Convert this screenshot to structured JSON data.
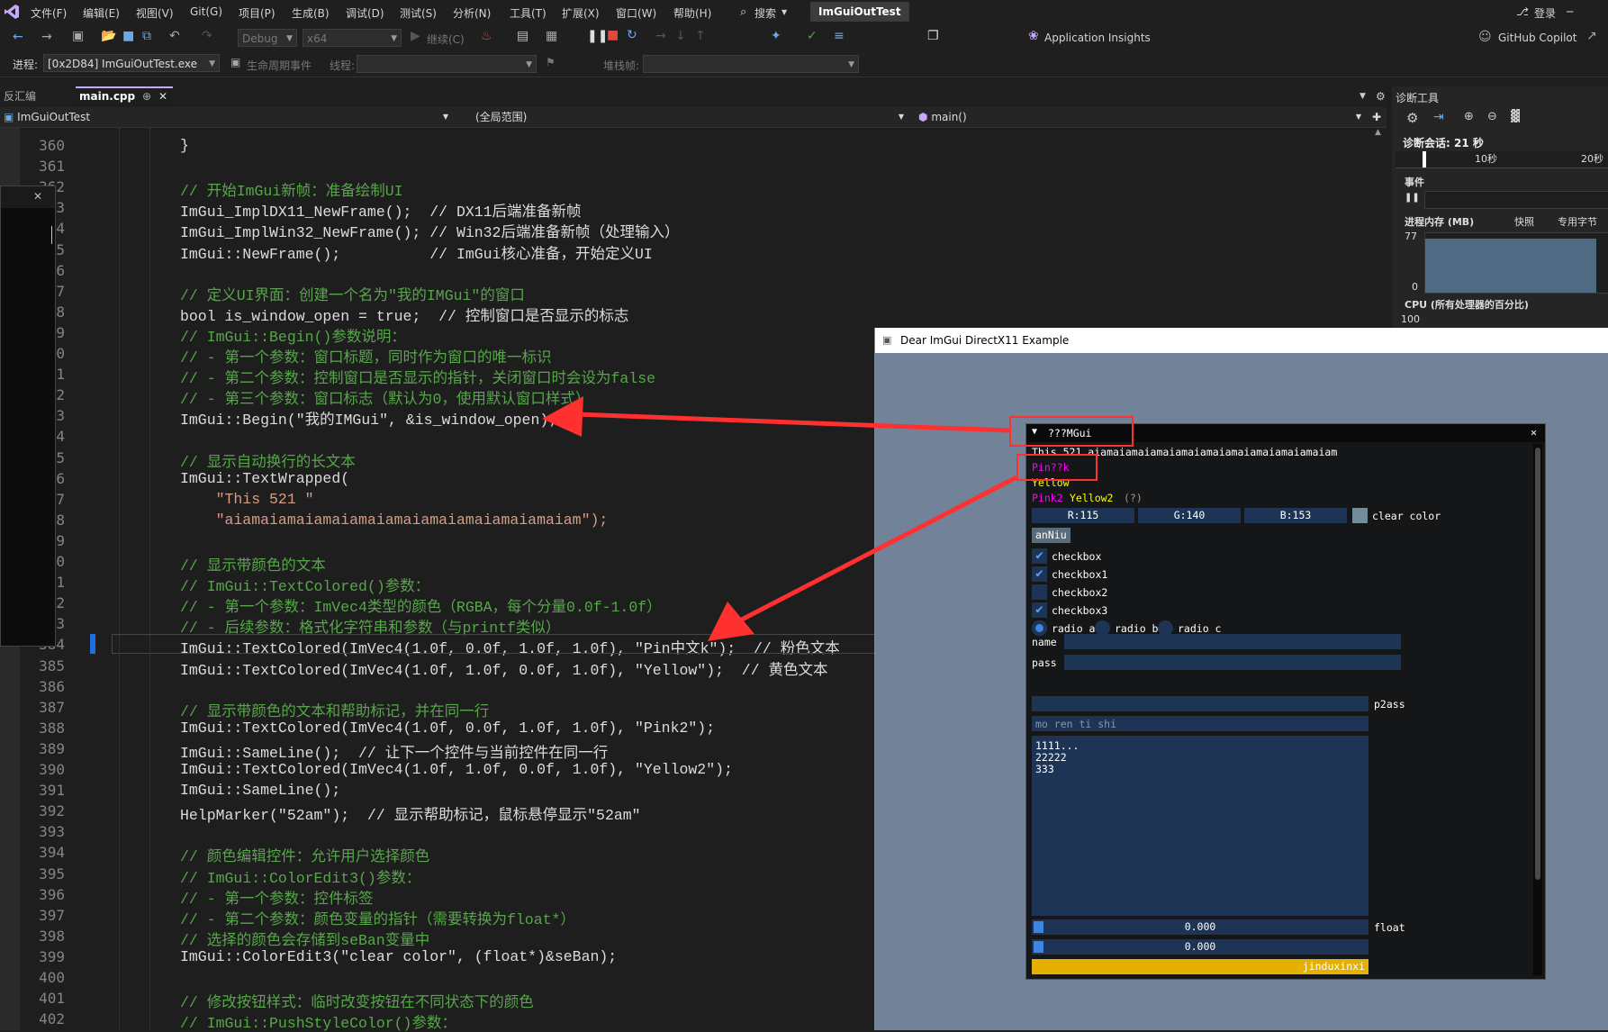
{
  "menu": {
    "items": [
      "文件(F)",
      "编辑(E)",
      "视图(V)",
      "Git(G)",
      "项目(P)",
      "生成(B)",
      "调试(D)",
      "测试(S)",
      "分析(N)",
      "工具(T)",
      "扩展(X)",
      "窗口(W)",
      "帮助(H)"
    ],
    "search_label": "搜索",
    "solution_title": "ImGuiOutTest",
    "login_label": "登录"
  },
  "toolbar": {
    "config": "Debug",
    "platform": "x64",
    "continue_label": "继续(C)",
    "app_insights": "Application Insights",
    "copilot": "GitHub Copilot",
    "process_label": "进程:",
    "process_value": "[0x2D84] ImGuiOutTest.exe",
    "lifecycle_label": "生命周期事件",
    "thread_label": "线程:",
    "stackframe_label": "堆栈帧:"
  },
  "tabs": {
    "disasm": "反汇编",
    "main": "main.cpp",
    "pin_icon": "pin-icon",
    "close_icon": "close-icon"
  },
  "navbar": {
    "project": "ImGuiOutTest",
    "scope": "(全局范围)",
    "member": "main()"
  },
  "editor": {
    "lines": [
      {
        "n": "360",
        "t": "}",
        "c": "plain"
      },
      {
        "n": "361",
        "t": "",
        "c": "plain"
      },
      {
        "n": "362",
        "t": "// 开始ImGui新帧：准备绘制UI",
        "c": "cmt"
      },
      {
        "n": "363",
        "t": "ImGui_ImplDX11_NewFrame();  // DX11后端准备新帧",
        "c": "mix"
      },
      {
        "n": "364",
        "t": "ImGui_ImplWin32_NewFrame(); // Win32后端准备新帧（处理输入）",
        "c": "mix"
      },
      {
        "n": "365",
        "t": "ImGui::NewFrame();          // ImGui核心准备，开始定义UI",
        "c": "mix"
      },
      {
        "n": "366",
        "t": "",
        "c": "plain"
      },
      {
        "n": "367",
        "t": "// 定义UI界面：创建一个名为\"我的IMGui\"的窗口",
        "c": "cmt"
      },
      {
        "n": "368",
        "t": "bool is_window_open = true;  // 控制窗口是否显示的标志",
        "c": "mix"
      },
      {
        "n": "369",
        "t": "// ImGui::Begin()参数说明：",
        "c": "cmt"
      },
      {
        "n": "370",
        "t": "// - 第一个参数：窗口标题，同时作为窗口的唯一标识",
        "c": "cmt"
      },
      {
        "n": "371",
        "t": "// - 第二个参数：控制窗口是否显示的指针，关闭窗口时会设为false",
        "c": "cmt"
      },
      {
        "n": "372",
        "t": "// - 第三个参数：窗口标志（默认为0，使用默认窗口样式）",
        "c": "cmt"
      },
      {
        "n": "373",
        "t": "ImGui::Begin(\"我的IMGui\", &is_window_open);",
        "c": "mix"
      },
      {
        "n": "374",
        "t": "",
        "c": "plain"
      },
      {
        "n": "375",
        "t": "// 显示自动换行的长文本",
        "c": "cmt"
      },
      {
        "n": "376",
        "t": "ImGui::TextWrapped(",
        "c": "mix"
      },
      {
        "n": "377",
        "t": "    \"This 521 \"",
        "c": "str"
      },
      {
        "n": "378",
        "t": "    \"aiamaiamaiamaiamaiamaiamaiamaiamaiamaiam\");",
        "c": "str"
      },
      {
        "n": "379",
        "t": "",
        "c": "plain"
      },
      {
        "n": "380",
        "t": "// 显示带颜色的文本",
        "c": "cmt"
      },
      {
        "n": "381",
        "t": "// ImGui::TextColored()参数：",
        "c": "cmt"
      },
      {
        "n": "382",
        "t": "// - 第一个参数：ImVec4类型的颜色（RGBA，每个分量0.0f-1.0f）",
        "c": "cmt"
      },
      {
        "n": "383",
        "t": "// - 后续参数：格式化字符串和参数（与printf类似）",
        "c": "cmt"
      },
      {
        "n": "384",
        "t": "ImGui::TextColored(ImVec4(1.0f, 0.0f, 1.0f, 1.0f), \"Pin中文k\");  // 粉色文本",
        "c": "mix"
      },
      {
        "n": "385",
        "t": "ImGui::TextColored(ImVec4(1.0f, 1.0f, 0.0f, 1.0f), \"Yellow\");  // 黄色文本",
        "c": "mix"
      },
      {
        "n": "386",
        "t": "",
        "c": "plain"
      },
      {
        "n": "387",
        "t": "// 显示带颜色的文本和帮助标记，并在同一行",
        "c": "cmt"
      },
      {
        "n": "388",
        "t": "ImGui::TextColored(ImVec4(1.0f, 0.0f, 1.0f, 1.0f), \"Pink2\");",
        "c": "mix"
      },
      {
        "n": "389",
        "t": "ImGui::SameLine();  // 让下一个控件与当前控件在同一行",
        "c": "mix"
      },
      {
        "n": "390",
        "t": "ImGui::TextColored(ImVec4(1.0f, 1.0f, 0.0f, 1.0f), \"Yellow2\");",
        "c": "mix"
      },
      {
        "n": "391",
        "t": "ImGui::SameLine();",
        "c": "mix"
      },
      {
        "n": "392",
        "t": "HelpMarker(\"52am\");  // 显示帮助标记，鼠标悬停显示\"52am\"",
        "c": "mix"
      },
      {
        "n": "393",
        "t": "",
        "c": "plain"
      },
      {
        "n": "394",
        "t": "// 颜色编辑控件：允许用户选择颜色",
        "c": "cmt"
      },
      {
        "n": "395",
        "t": "// ImGui::ColorEdit3()参数：",
        "c": "cmt"
      },
      {
        "n": "396",
        "t": "// - 第一个参数：控件标签",
        "c": "cmt"
      },
      {
        "n": "397",
        "t": "// - 第二个参数：颜色变量的指针（需要转换为float*）",
        "c": "cmt"
      },
      {
        "n": "398",
        "t": "// 选择的颜色会存储到seBan变量中",
        "c": "cmt"
      },
      {
        "n": "399",
        "t": "ImGui::ColorEdit3(\"clear color\", (float*)&seBan);",
        "c": "mix"
      },
      {
        "n": "400",
        "t": "",
        "c": "plain"
      },
      {
        "n": "401",
        "t": "// 修改按钮样式：临时改变按钮在不同状态下的颜色",
        "c": "cmt"
      },
      {
        "n": "402",
        "t": "// ImGui::PushStyleColor()参数：",
        "c": "cmt"
      }
    ]
  },
  "diag": {
    "title": "诊断工具",
    "session": "诊断会话: 21 秒",
    "t10": "10秒",
    "t20": "20秒",
    "events": "事件",
    "memory": "进程内存 (MB)",
    "snapshot": "快照",
    "private_bytes": "专用字节",
    "mem_max": "77",
    "mem_min": "0",
    "cpu": "CPU (所有处理器的百分比)",
    "cpu_max": "100"
  },
  "dx_window": {
    "title": "Dear ImGui DirectX11 Example"
  },
  "imgui": {
    "title": "???MGui",
    "wrapped": "This 521 aiamaiamaiamaiamaiamaiamaiamaiamaiamaiam",
    "pink": "Pin??k",
    "yellow": "Yellow",
    "pink2": "Pink2",
    "yellow2": "Yellow2",
    "help": "(?)",
    "r": "R:115",
    "g": "G:140",
    "b": "B:153",
    "clear_color": "clear color",
    "clear_color_hex": "#738c99",
    "button": "anNiu",
    "checkboxes": [
      {
        "label": "checkbox",
        "checked": true
      },
      {
        "label": "checkbox1",
        "checked": true
      },
      {
        "label": "checkbox2",
        "checked": false
      },
      {
        "label": "checkbox3",
        "checked": true
      }
    ],
    "radios": [
      "radio a",
      "radio b",
      "radio c"
    ],
    "name_label": "name",
    "pass_label": "pass",
    "p2ass_label": "p2ass",
    "hint": "mo ren ti shi",
    "multiline": [
      "1111...",
      "22222",
      "333"
    ],
    "float_value1": "0.000",
    "float_value2": "0.000",
    "float_label": "float",
    "progress_label": "jinduxinxi"
  },
  "colors": {
    "accent": "#569cd6",
    "comment": "#57a64a",
    "annotation_red": "#ff3030",
    "progress": "#e6b000",
    "pink": "#ff00ff",
    "yellow": "#ffff00"
  }
}
